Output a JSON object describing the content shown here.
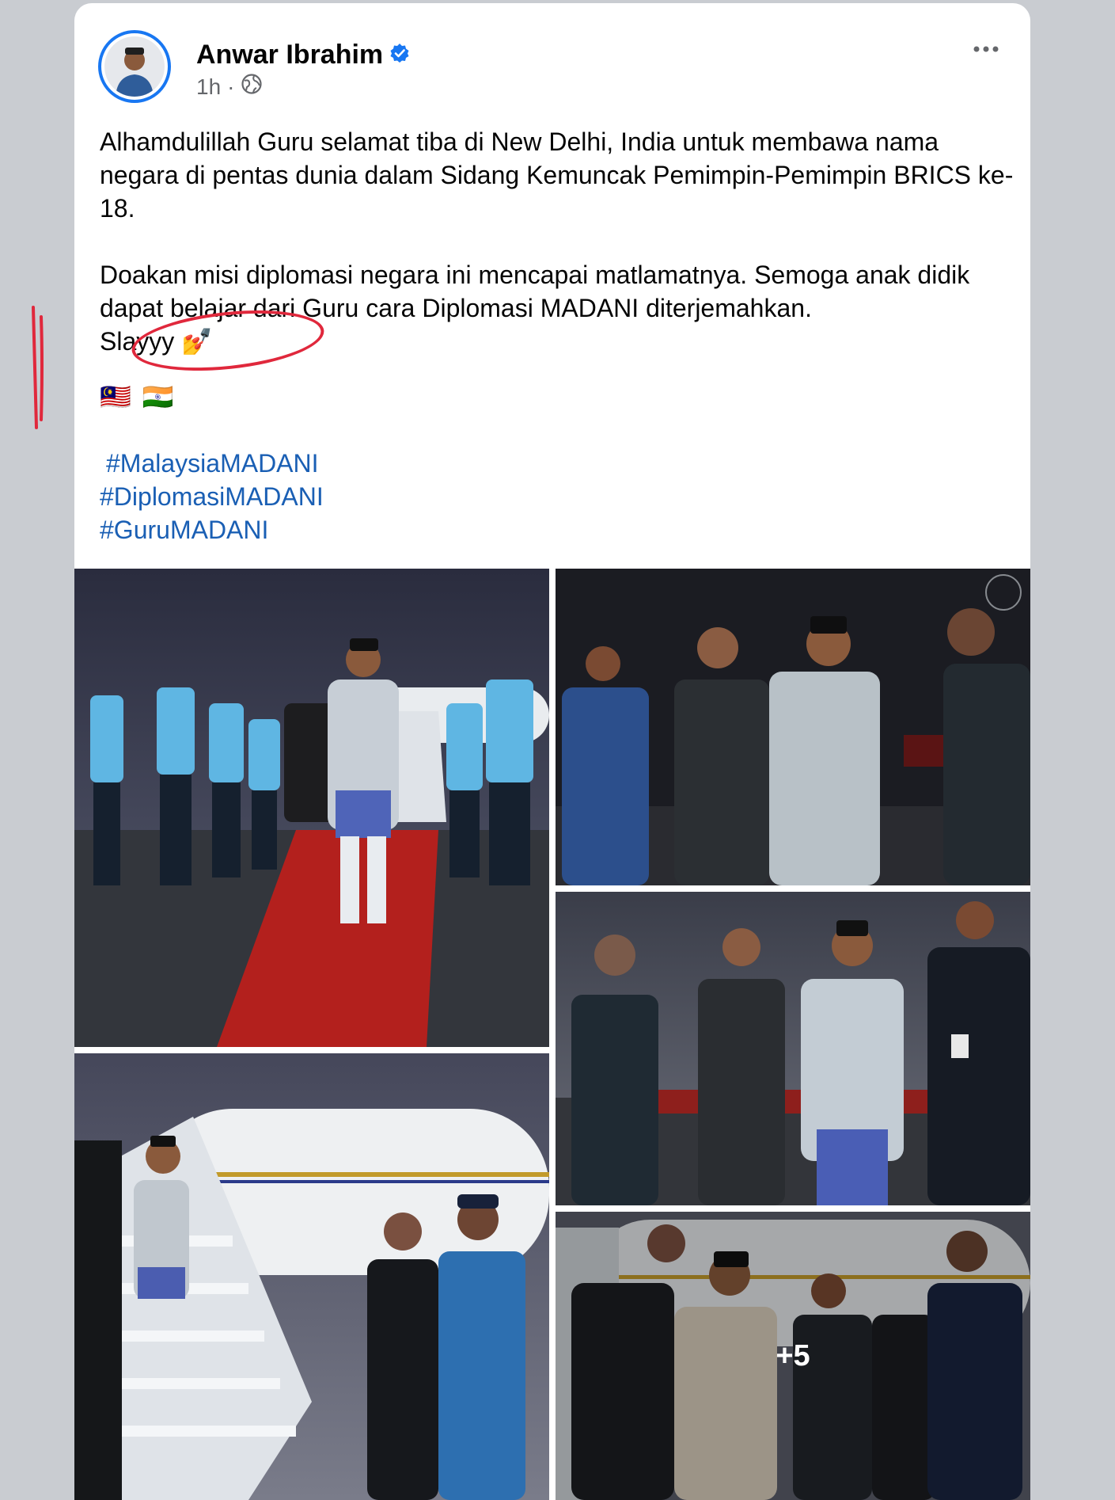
{
  "post": {
    "author": "Anwar Ibrahim",
    "time": "1h",
    "separator": "·",
    "text_p1": "Alhamdulillah Guru selamat tiba di New Delhi, India untuk membawa nama negara di pentas dunia dalam Sidang Kemuncak Pemimpin-Pemimpin BRICS ke-18.",
    "text_p2": "Doakan misi diplomasi negara ini mencapai matlamatnya. Semoga anak didik dapat belajar dari Guru cara Diplomasi MADANI diterjemahkan.",
    "text_p3": "Slayyy",
    "emoji_p3": "💅",
    "flags": [
      "🇲🇾",
      "🇮🇳"
    ],
    "hashtags": [
      "#MalaysiaMADANI",
      "#DiplomasiMADANI",
      "#GuruMADANI"
    ],
    "more_photos": "+5"
  },
  "icons": {
    "verified": "verified-badge-icon",
    "privacy": "globe-icon",
    "more": "more-options-icon"
  },
  "colors": {
    "background": "#c9ccd1",
    "card": "#ffffff",
    "hashtag": "#1a5fb4",
    "verified": "#1877f2",
    "annotation": "#e0283c"
  }
}
